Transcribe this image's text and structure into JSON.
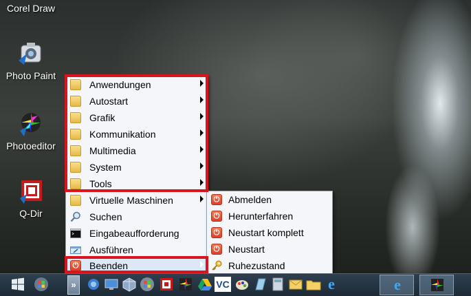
{
  "desktop": {
    "icons": [
      {
        "label": "Corel Draw",
        "icon": "corel-draw-icon"
      },
      {
        "label": "Photo Paint",
        "icon": "photo-paint-icon"
      },
      {
        "label": "Photoeditor",
        "icon": "photoeditor-icon"
      },
      {
        "label": "Q-Dir",
        "icon": "q-dir-icon"
      }
    ]
  },
  "main_menu": {
    "items": [
      {
        "label": "Anwendungen",
        "icon": "folder-icon",
        "submenu": true
      },
      {
        "label": "Autostart",
        "icon": "folder-icon",
        "submenu": true
      },
      {
        "label": "Grafik",
        "icon": "folder-icon",
        "submenu": true
      },
      {
        "label": "Kommunikation",
        "icon": "folder-icon",
        "submenu": true
      },
      {
        "label": "Multimedia",
        "icon": "folder-icon",
        "submenu": true
      },
      {
        "label": "System",
        "icon": "folder-icon",
        "submenu": true
      },
      {
        "label": "Tools",
        "icon": "folder-icon",
        "submenu": true
      },
      {
        "label": "Virtuelle Maschinen",
        "icon": "folder-icon",
        "submenu": true
      },
      {
        "label": "Suchen",
        "icon": "magnifier-icon",
        "submenu": false
      },
      {
        "label": "Eingabeaufforderung",
        "icon": "command-prompt-icon",
        "submenu": false
      },
      {
        "label": "Ausführen",
        "icon": "run-icon",
        "submenu": false
      },
      {
        "label": "Beenden",
        "icon": "power-icon",
        "submenu": true,
        "highlighted": true
      }
    ]
  },
  "shutdown_submenu": {
    "items": [
      {
        "label": "Abmelden",
        "icon": "power-icon"
      },
      {
        "label": "Herunterfahren",
        "icon": "power-icon"
      },
      {
        "label": "Neustart komplett",
        "icon": "power-icon"
      },
      {
        "label": "Neustart",
        "icon": "power-icon"
      },
      {
        "label": "Ruhezustand",
        "icon": "key-icon"
      }
    ]
  },
  "taskbar": {
    "items": [
      "windows-start-icon",
      "windows7-orb-icon",
      "chevron-expand-icon",
      "network-icon",
      "computer-icon",
      "virtualbox-icon",
      "windows-orb-icon",
      "q-dir-icon",
      "photoeditor-icon",
      "google-drive-icon",
      "veracrypt-icon",
      "paint-icon",
      "notepad-icon",
      "calculator-icon",
      "mail-icon",
      "explorer-folder-icon",
      "internet-explorer-icon",
      "internet-explorer-active-icon",
      "photoeditor-active-icon"
    ]
  },
  "colors": {
    "highlight_box": "#d8141e",
    "menu_bg": "#f4f6f9",
    "taskbar": "#1d2a36"
  }
}
